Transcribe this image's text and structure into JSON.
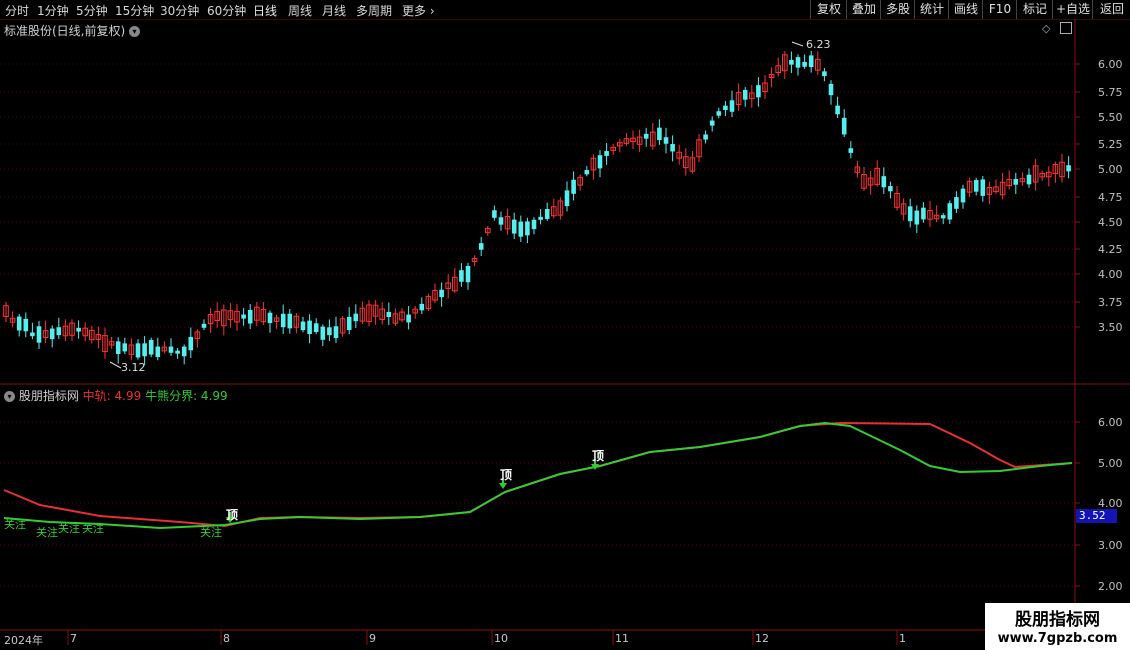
{
  "toolbar": {
    "periods": [
      "分时",
      "1分钟",
      "5分钟",
      "15分钟",
      "30分钟",
      "60分钟",
      "日线",
      "周线",
      "月线",
      "多周期",
      "更多"
    ],
    "right_buttons": [
      "复权",
      "叠加",
      "多股",
      "统计",
      "画线",
      "F10",
      "标记",
      "+自选",
      "返回"
    ]
  },
  "main_title": "标准股份(日线,前复权)",
  "indicator": {
    "name": "股朋指标网",
    "mid_label": "中轨: 4.99",
    "line_label": "牛熊分界: 4.99",
    "mid_color": "#e83030",
    "line_color": "#33cc33"
  },
  "price_axis": [
    "6.00",
    "5.75",
    "5.50",
    "5.25",
    "5.00",
    "4.75",
    "4.50",
    "4.25",
    "4.00",
    "3.75",
    "3.50"
  ],
  "ind_axis": [
    "6.00",
    "5.00",
    "4.00",
    "3.00",
    "2.00"
  ],
  "current_price_tag": "3.52",
  "annotations": {
    "high": "6.23",
    "low": "3.12",
    "top_signal": "顶",
    "focus_signal": "关注"
  },
  "time_axis": [
    "2024年",
    "7",
    "8",
    "9",
    "10",
    "11",
    "12",
    "1"
  ],
  "watermark": {
    "line1": "股朋指标网",
    "line2": "www.7gpzb.com"
  },
  "colors": {
    "up": "#ff3232",
    "down": "#54f0f0",
    "grid": "#5a0000"
  }
}
